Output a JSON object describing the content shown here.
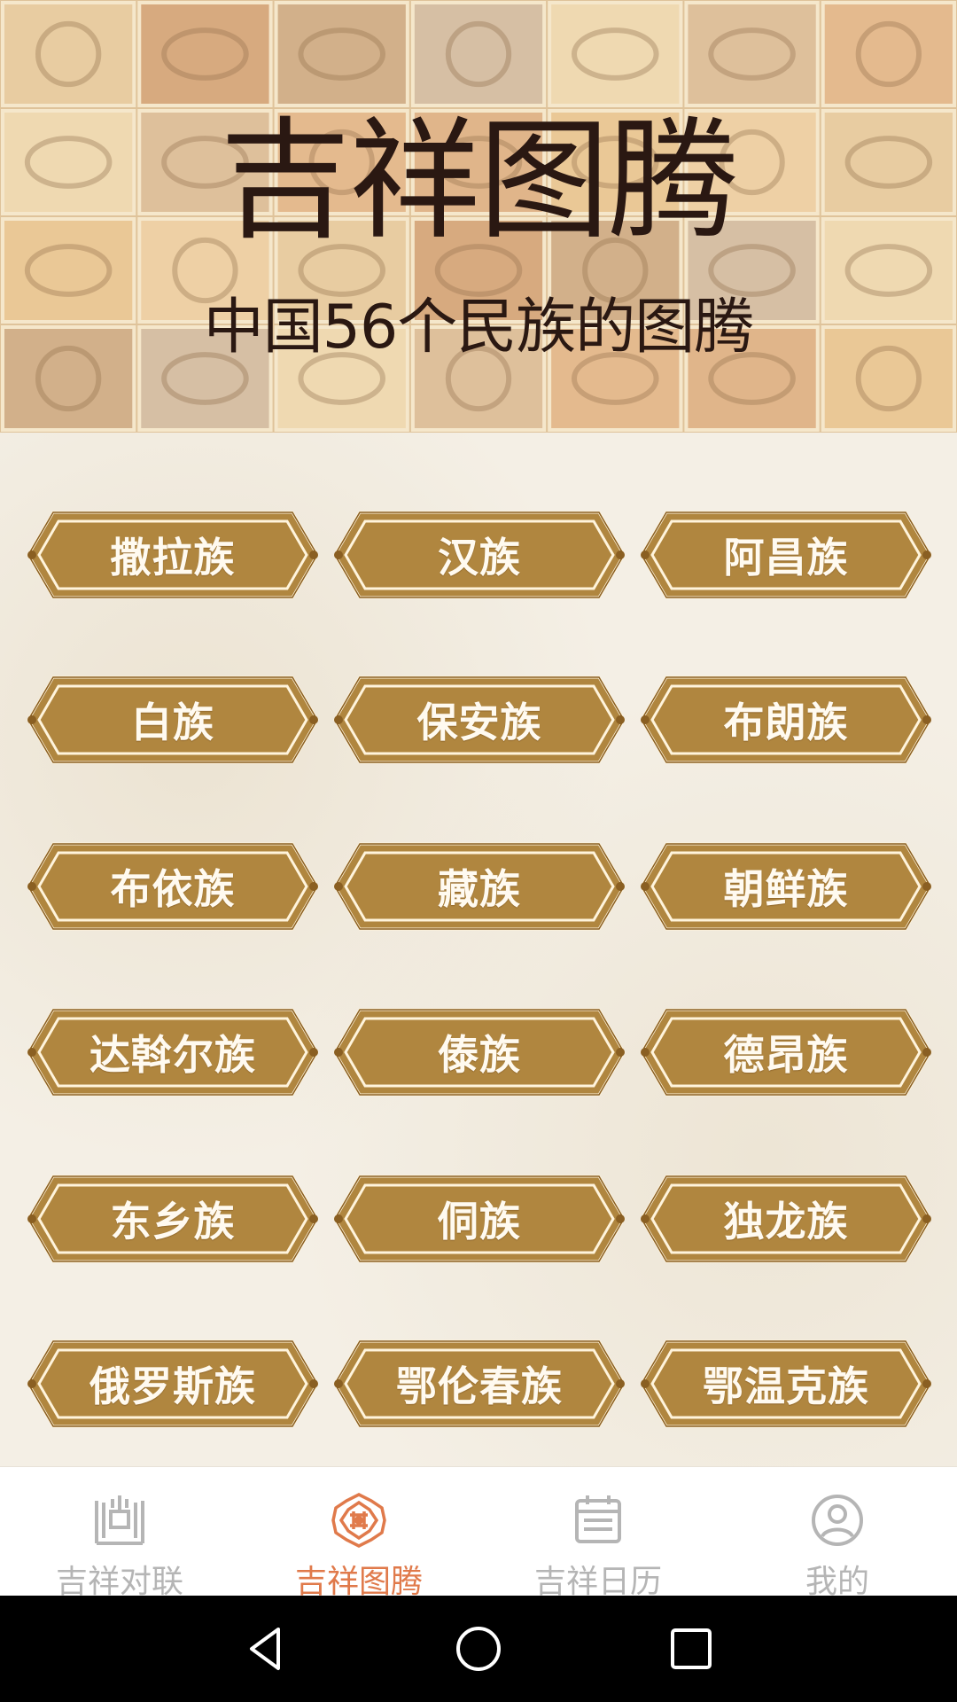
{
  "banner": {
    "title": "吉祥图腾",
    "subtitle": "中国56个民族的图腾"
  },
  "ethnic_buttons": [
    "撒拉族",
    "汉族",
    "阿昌族",
    "白族",
    "保安族",
    "布朗族",
    "布依族",
    "藏族",
    "朝鲜族",
    "达斡尔族",
    "傣族",
    "德昂族",
    "东乡族",
    "侗族",
    "独龙族",
    "俄罗斯族",
    "鄂伦春族",
    "鄂温克族"
  ],
  "tabbar": {
    "items": [
      {
        "label": "吉祥对联",
        "icon": "couplet-gate-icon",
        "active": false
      },
      {
        "label": "吉祥图腾",
        "icon": "totem-medallion-icon",
        "active": true
      },
      {
        "label": "吉祥日历",
        "icon": "calendar-icon",
        "active": false
      },
      {
        "label": "我的",
        "icon": "profile-icon",
        "active": false
      }
    ]
  },
  "navbar": {
    "buttons": [
      {
        "icon": "back-triangle-icon"
      },
      {
        "icon": "home-circle-icon"
      },
      {
        "icon": "recents-square-icon"
      }
    ]
  },
  "colors": {
    "button_gold": "#b0863f",
    "button_border": "#8a5f22",
    "active_tab": "#e07a4b",
    "inactive_tab": "#b5b5b5",
    "banner_text": "#2a1812"
  }
}
